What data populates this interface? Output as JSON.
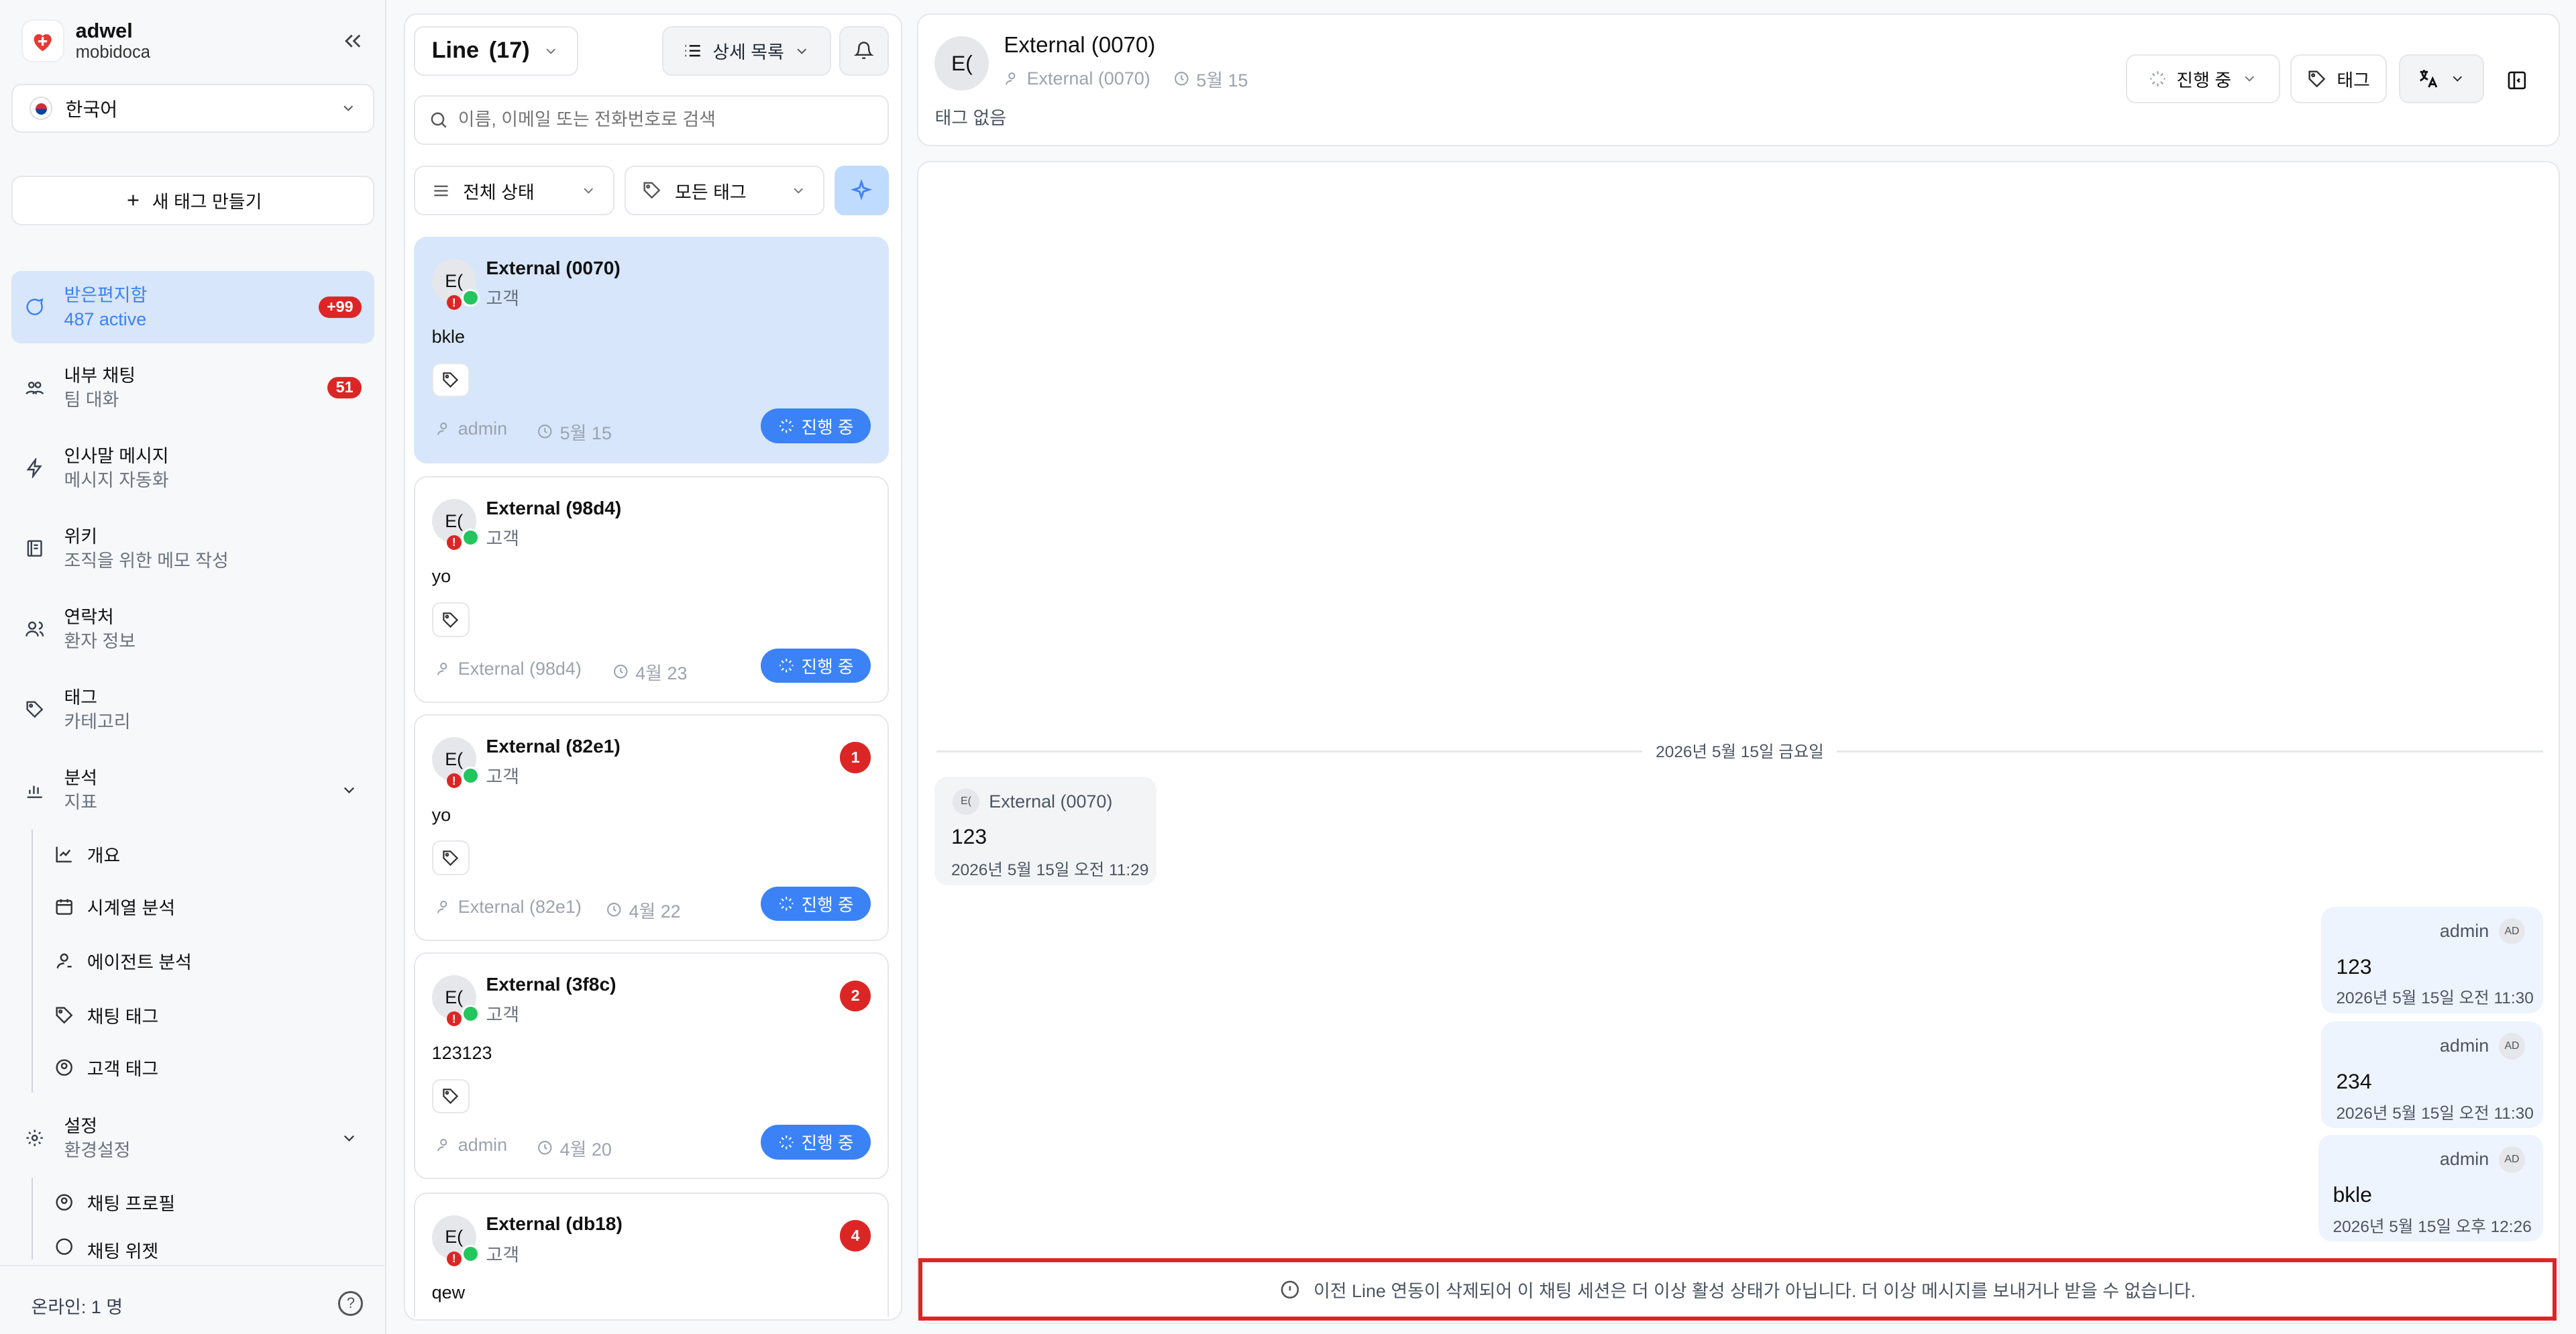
{
  "app": {
    "name": "adwel",
    "workspace": "mobidoca",
    "language": "한국어",
    "new_tag_label": "새 태그 만들기",
    "online_status": "온라인: 1 명"
  },
  "sidebar": {
    "items": [
      {
        "label": "받은편지함",
        "sub": "487 active",
        "badge": "+99"
      },
      {
        "label": "내부 채팅",
        "sub": "팀 대화",
        "badge": "51"
      },
      {
        "label": "인사말 메시지",
        "sub": "메시지 자동화"
      },
      {
        "label": "위키",
        "sub": "조직을 위한 메모 작성"
      },
      {
        "label": "연락처",
        "sub": "환자 정보"
      },
      {
        "label": "태그",
        "sub": "카테고리"
      },
      {
        "label": "분석",
        "sub": "지표"
      },
      {
        "label": "설정",
        "sub": "환경설정"
      }
    ],
    "analytics_sub": [
      "개요",
      "시계열 분석",
      "에이전트 분석",
      "채팅 태그",
      "고객 태그"
    ],
    "settings_sub": [
      "채팅 프로필",
      "채팅 위젯"
    ]
  },
  "list": {
    "channel": "Line",
    "count": "(17)",
    "view_mode": "상세 목록",
    "search_placeholder": "이름, 이메일 또는 전화번호로 검색",
    "filter_status": "전체 상태",
    "filter_tags": "모든 태그",
    "conversations": [
      {
        "avatar": "E(",
        "name": "External (0070)",
        "role": "고객",
        "preview": "bkle",
        "agent": "admin",
        "date": "5월 15",
        "status": "진행 중"
      },
      {
        "avatar": "E(",
        "name": "External (98d4)",
        "role": "고객",
        "preview": "yo",
        "agent": "External (98d4)",
        "date": "4월 23",
        "status": "진행 중"
      },
      {
        "avatar": "E(",
        "name": "External (82e1)",
        "role": "고객",
        "preview": "yo",
        "agent": "External (82e1)",
        "date": "4월 22",
        "status": "진행 중",
        "unread": "1"
      },
      {
        "avatar": "E(",
        "name": "External (3f8c)",
        "role": "고객",
        "preview": "123123",
        "agent": "admin",
        "date": "4월 20",
        "status": "진행 중",
        "unread": "2"
      },
      {
        "avatar": "E(",
        "name": "External (db18)",
        "role": "고객",
        "preview": "qew",
        "unread": "4"
      }
    ]
  },
  "chat": {
    "avatar": "E(",
    "name": "External (0070)",
    "assignee": "External (0070)",
    "date": "5월 15",
    "no_tags": "태그 없음",
    "status_btn": "진행 중",
    "tag_btn": "태그",
    "date_divider": "2026년 5월 15일 금요일",
    "messages": [
      {
        "avatar": "E(",
        "sender": "External (0070)",
        "text": "123",
        "time": "2026년 5월 15일 오전 11:29"
      },
      {
        "avatar": "AD",
        "sender": "admin",
        "text": "123",
        "time": "2026년 5월 15일 오전 11:30"
      },
      {
        "avatar": "AD",
        "sender": "admin",
        "text": "234",
        "time": "2026년 5월 15일 오전 11:30"
      },
      {
        "avatar": "AD",
        "sender": "admin",
        "text": "bkle",
        "time": "2026년 5월 15일 오후 12:26"
      }
    ],
    "notice": "이전 Line 연동이 삭제되어 이 채팅 세션은 더 이상 활성 상태가 아닙니다. 더 이상 메시지를 보내거나 받을 수 없습니다."
  },
  "colors": {
    "accent": "#3b82f6",
    "danger": "#dc2626",
    "active_bg": "#d7e6fb"
  }
}
